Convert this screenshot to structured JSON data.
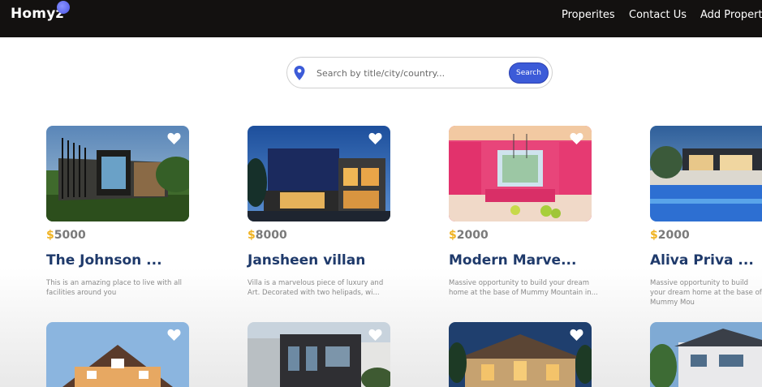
{
  "header": {
    "logo": "Homyz",
    "nav": [
      "Properites",
      "Contact Us",
      "Add Property"
    ]
  },
  "search": {
    "placeholder": "Search by title/city/country...",
    "button_label": "Search",
    "icon": "location-pin-icon"
  },
  "colors": {
    "header_bg": "#131110",
    "accent_blue": "#3c5bd8",
    "price_symbol": "#f0b323",
    "title": "#1f3a6b"
  },
  "properties": [
    {
      "currency": "$",
      "price": "5000",
      "title": "The Johnson ...",
      "description": "This is an amazing place to live with all facilities around you"
    },
    {
      "currency": "$",
      "price": "8000",
      "title": "Jansheen villan",
      "description": "Villa is a marvelous piece of luxury and Art. Decorated with two helipads, wi..."
    },
    {
      "currency": "$",
      "price": "2000",
      "title": "Modern Marve...",
      "description": "Massive opportunity to build your dream home at the base of Mummy Mountain in..."
    },
    {
      "currency": "$",
      "price": "2000",
      "title": "Aliva Priva ...",
      "description": "Massive opportunity to build your dream home at the base of Mummy Mou"
    }
  ]
}
